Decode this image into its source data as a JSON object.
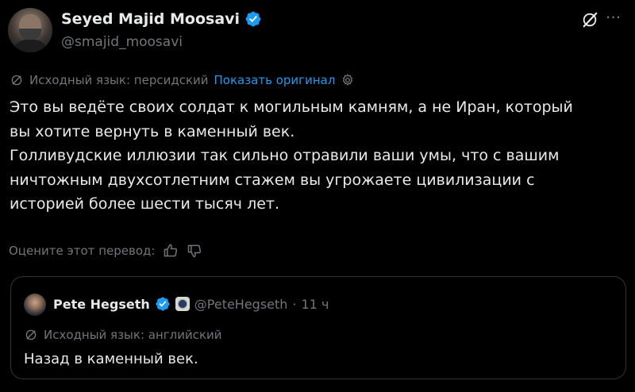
{
  "author": {
    "name": "Seyed Majid Moosavi",
    "handle": "@smajid_moosavi"
  },
  "translation": {
    "source_language_text": "Исходный язык: персидский",
    "show_original_link": "Показать оригинал"
  },
  "tweet": {
    "lines": [
      "Это вы ведёте своих солдат к могильным камням, а не Иран, который",
      "вы хотите вернуть в каменный век.",
      "Голливудские иллюзии так сильно отравили ваши умы, что с вашим",
      "ничтожным двухсотлетним стажем вы угрожаете цивилизации с",
      "историей более шести тысяч лет."
    ]
  },
  "rate_translation": {
    "label": "Оцените этот перевод:"
  },
  "quote": {
    "name": "Pete Hegseth",
    "handle": "@PeteHegseth",
    "separator": "·",
    "time": "11 ч",
    "source_language_text": "Исходный язык: английский",
    "text": "Назад в каменный век."
  },
  "icons": {
    "verified": "verified-badge-icon",
    "grok": "grok-icon",
    "more": "more-icon",
    "translate": "translate-icon",
    "settings": "gear-icon",
    "thumbs_up": "thumbs-up-icon",
    "thumbs_down": "thumbs-down-icon",
    "gov_seal": "government-seal-icon"
  },
  "colors": {
    "background": "#000000",
    "text": "#e7e9ea",
    "secondary": "#71767b",
    "link": "#1d9bf0",
    "verified": "#1d9bf0",
    "border": "#2f3336"
  }
}
